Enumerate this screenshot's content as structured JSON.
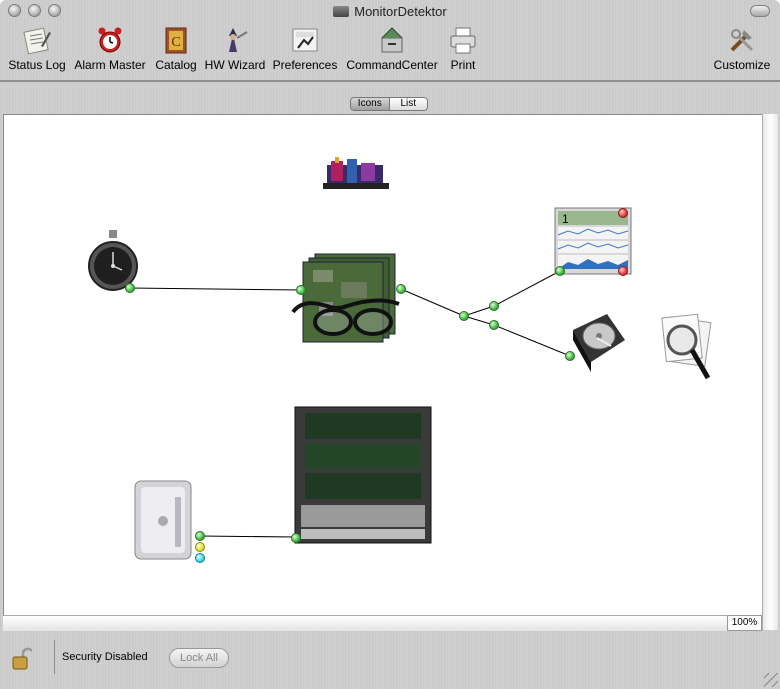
{
  "window": {
    "title": "MonitorDetektor"
  },
  "toolbar": {
    "items": [
      {
        "label": "Status Log"
      },
      {
        "label": "Alarm Master"
      },
      {
        "label": "Catalog"
      },
      {
        "label": "HW Wizard"
      },
      {
        "label": "Preferences"
      },
      {
        "label": "CommandCenter"
      },
      {
        "label": "Print"
      },
      {
        "label": "Customize"
      }
    ]
  },
  "view_toggle": {
    "icons_label": "Icons",
    "list_label": "List",
    "selected": "Icons"
  },
  "canvas": {
    "zoom": "100%"
  },
  "status": {
    "security_text": "Security Disabled",
    "lock_all_label": "Lock All"
  },
  "nodes": [
    "stopwatch",
    "network-card",
    "circuit-boards-with-glasses",
    "chart-monitor",
    "hard-drive",
    "search-documents",
    "server-rack",
    "power-mac-g4"
  ],
  "colors": {
    "port_green": "#3fbb3f",
    "port_yellow": "#e0e03a",
    "port_cyan": "#3ad8e0",
    "port_red": "#e03a3a"
  }
}
